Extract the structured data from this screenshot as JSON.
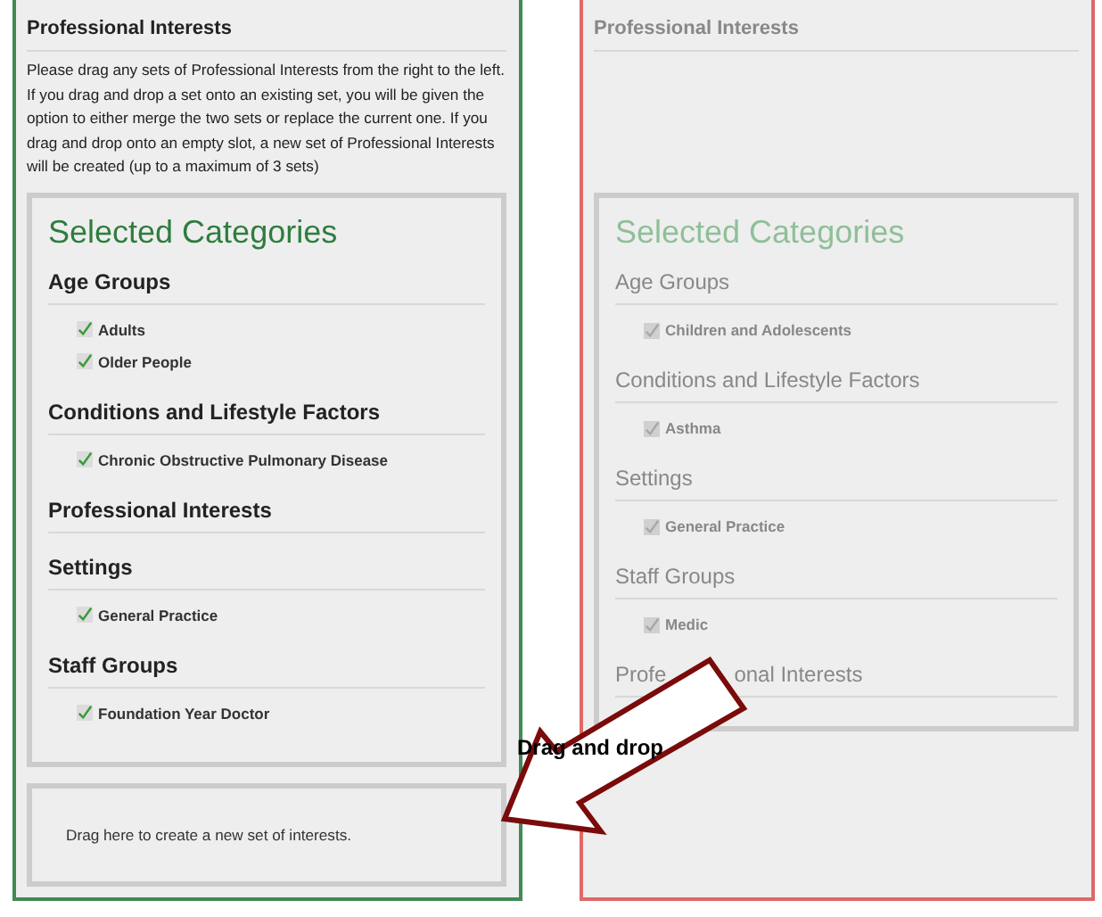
{
  "panels": [
    {
      "kind": "target",
      "disabled": false,
      "heading": "Professional Interests",
      "description": "Please drag any sets of Professional Interests from the right to the left. If you drag and drop a set onto an existing set, you will be given the option to either merge the two sets or replace the current one. If you drag and drop onto an empty slot, a new set of Professional Interests will be created (up to a maximum of 3 sets)",
      "categories": {
        "title": "Selected Categories",
        "groups": [
          {
            "heading": "Age Groups",
            "items": [
              {
                "label": "Adults",
                "checked": true
              },
              {
                "label": "Older People",
                "checked": true
              }
            ]
          },
          {
            "heading": "Conditions and Lifestyle Factors",
            "items": [
              {
                "label": "Chronic Obstructive Pulmonary Disease",
                "checked": true
              }
            ]
          },
          {
            "heading": "Professional Interests"
          },
          {
            "heading": "Settings",
            "items": [
              {
                "label": "General Practice",
                "checked": true
              }
            ]
          },
          {
            "heading": "Staff Groups",
            "items": [
              {
                "label": "Foundation Year Doctor",
                "checked": true
              }
            ]
          }
        ]
      },
      "drop_zone": "Drag here to create a new set of interests."
    },
    {
      "kind": "source",
      "disabled": true,
      "heading": "Professional Interests",
      "categories": {
        "title": "Selected Categories",
        "groups": [
          {
            "heading": "Age Groups",
            "items": [
              {
                "label": "Children and Adolescents",
                "checked": true
              }
            ]
          },
          {
            "heading": "Conditions and Lifestyle Factors",
            "items": [
              {
                "label": "Asthma",
                "checked": true
              }
            ]
          },
          {
            "heading": "Settings",
            "items": [
              {
                "label": "General Practice",
                "checked": true
              }
            ]
          },
          {
            "heading": "Staff Groups",
            "items": [
              {
                "label": "Medic",
                "checked": true
              }
            ]
          },
          {
            "heading_fragments": [
              "Profe",
              "onal Interests"
            ]
          }
        ]
      }
    }
  ],
  "annotation": {
    "label": "Drag and drop"
  }
}
